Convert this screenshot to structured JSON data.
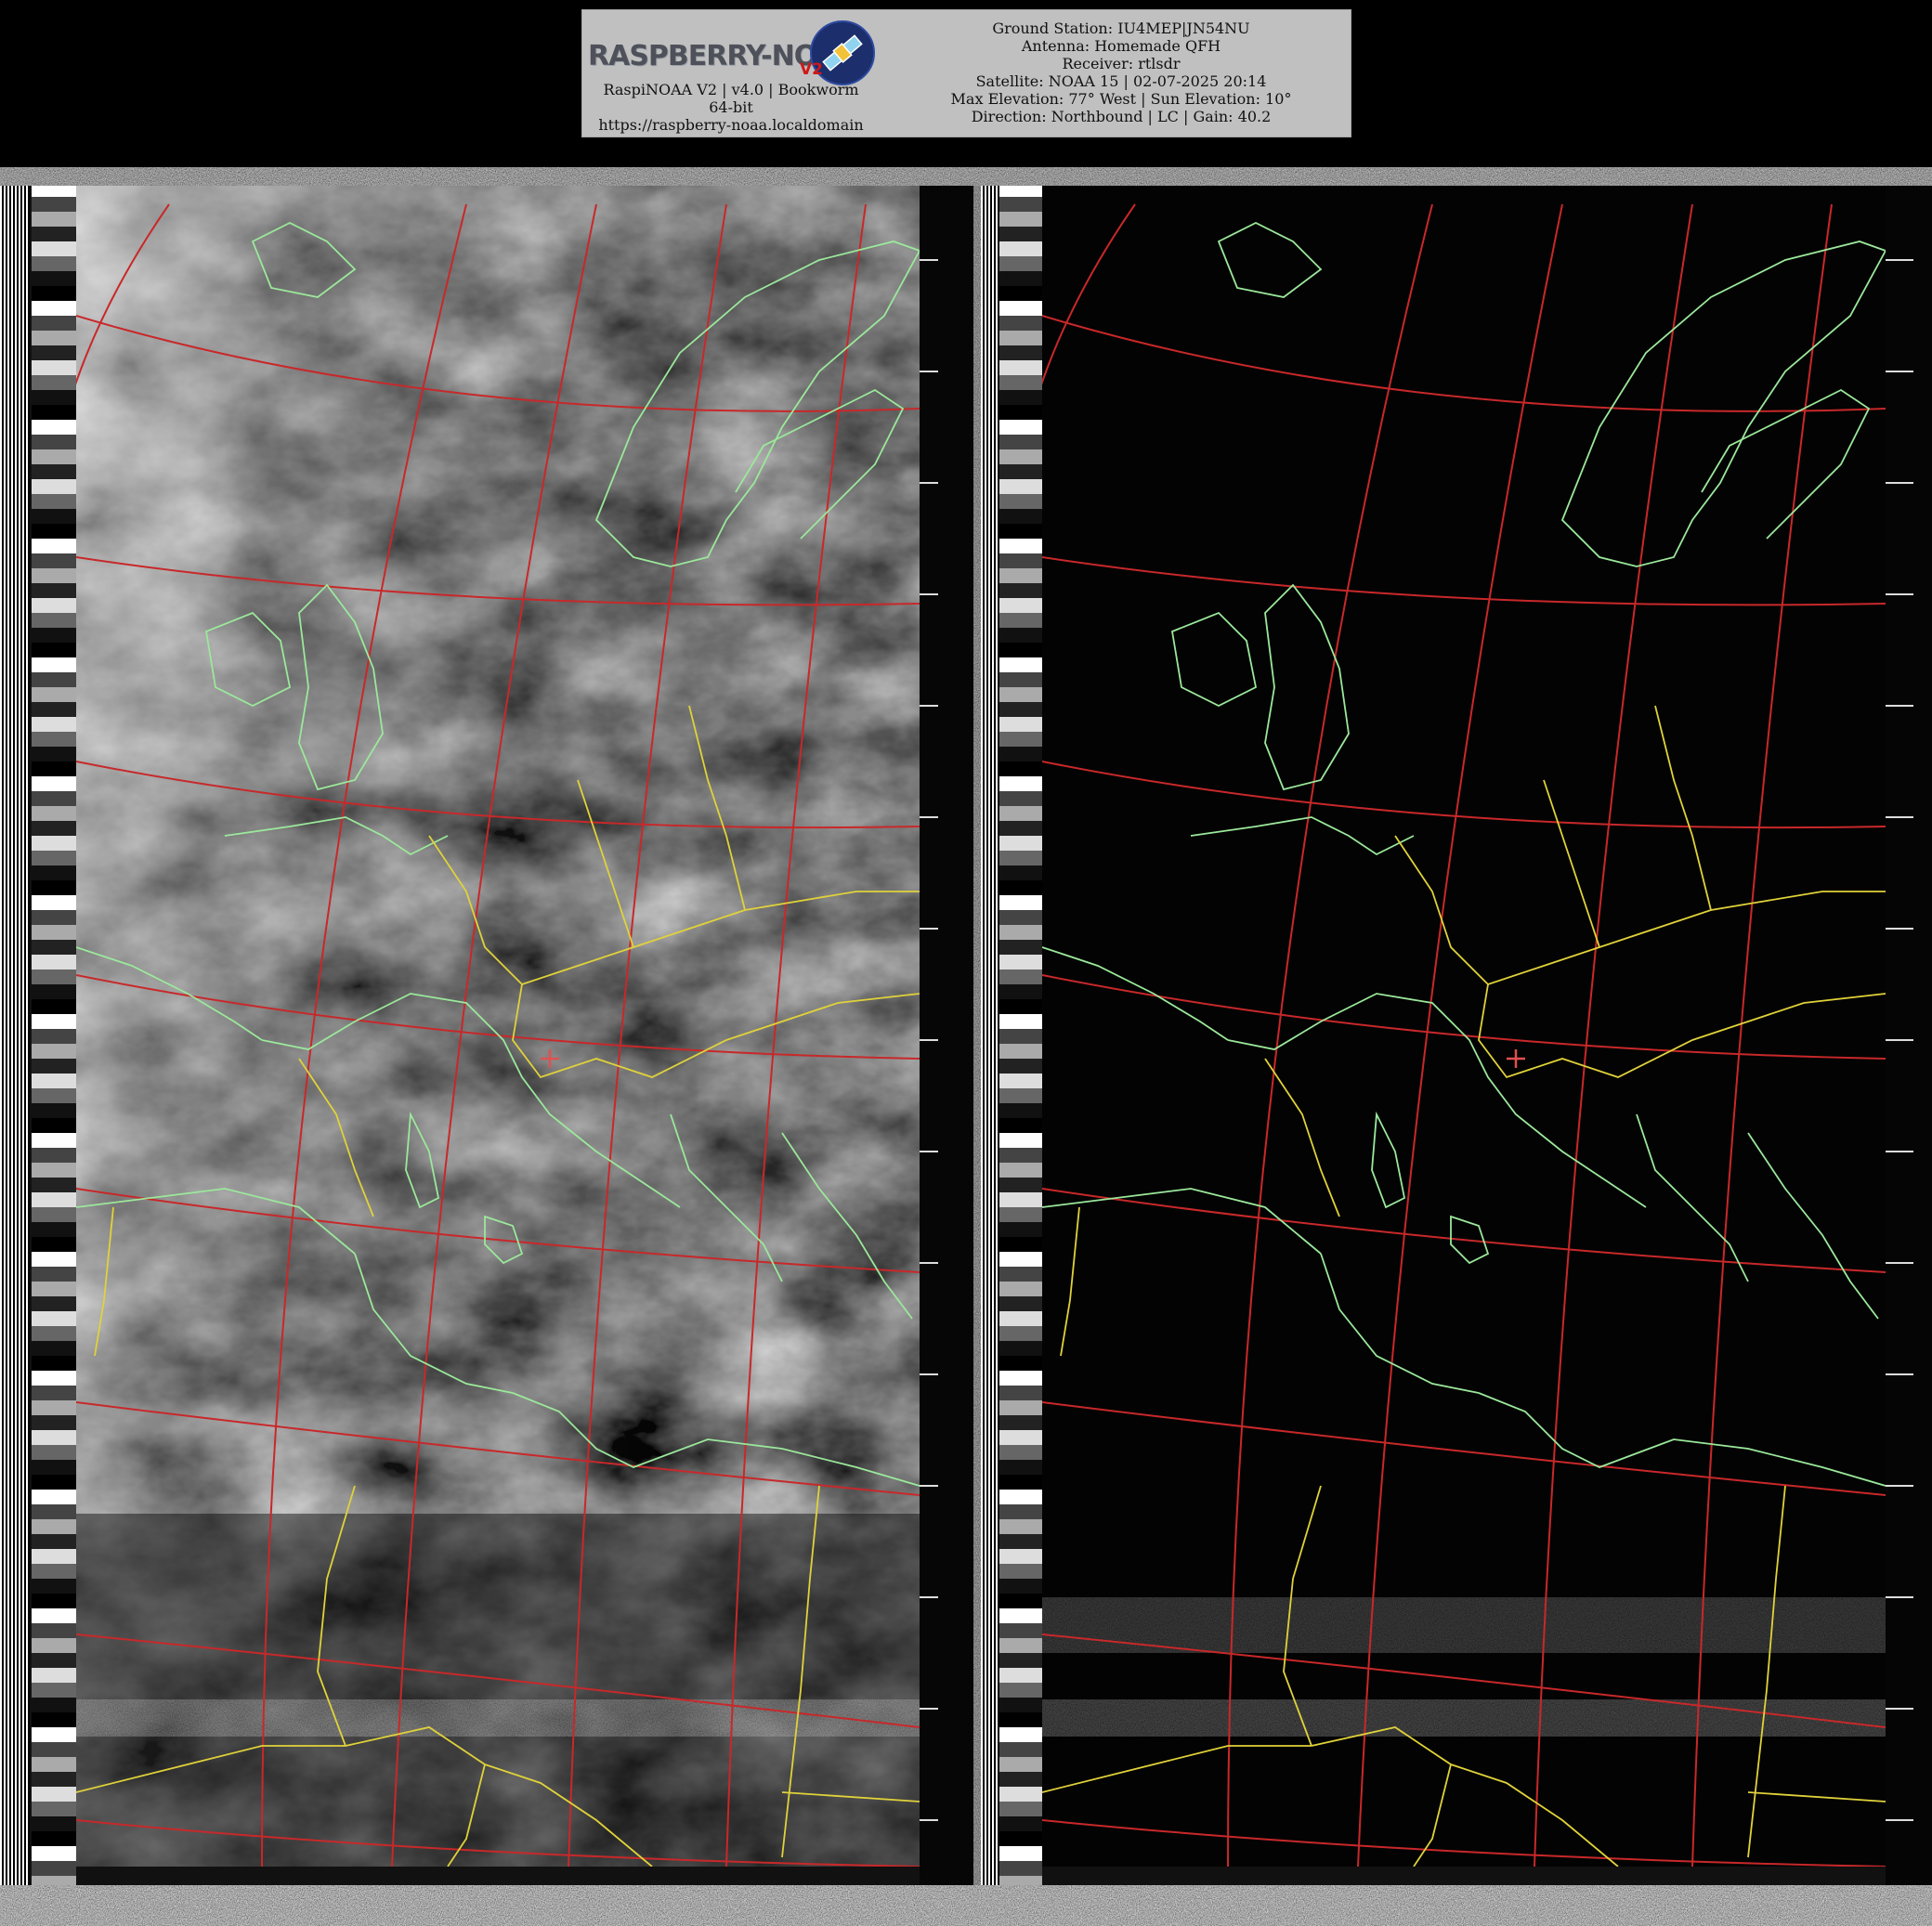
{
  "header": {
    "logo": "RASPBERRY-NOAA",
    "logo_version": "V2",
    "software": "RaspiNOAA V2 | v4.0 | Bookworm 64-bit",
    "url": "https://raspberry-noaa.localdomain"
  },
  "pass_info": {
    "ground_station": "Ground Station: IU4MEP|JN54NU",
    "antenna": "Antenna: Homemade QFH",
    "receiver": "Receiver: rtlsdr",
    "satellite": "Satellite: NOAA 15 | 02-07-2025 20:14",
    "elevation": "Max Elevation: 77° West | Sun Elevation: 10°",
    "direction": "Direction: Northbound | LC | Gain: 40.2"
  },
  "image": {
    "channel_a": "visible (with clouds)",
    "channel_b": "infrared (dark)",
    "overlay_colors": {
      "graticule": "#c8282a",
      "coastline": "#9be89b",
      "borders": "#e0d23a",
      "center_cross": "#e05050"
    }
  }
}
